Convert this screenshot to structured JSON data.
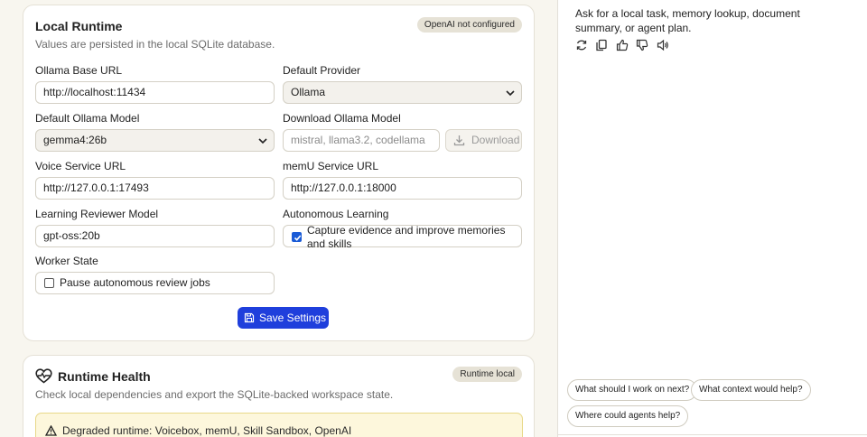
{
  "settings": {
    "title": "Local Runtime",
    "subtitle": "Values are persisted in the local SQLite database.",
    "badge": "OpenAI not configured",
    "ollama_base_url": {
      "label": "Ollama Base URL",
      "value": "http://localhost:11434"
    },
    "default_provider": {
      "label": "Default Provider",
      "value": "Ollama"
    },
    "default_model": {
      "label": "Default Ollama Model",
      "value": "gemma4:26b"
    },
    "download_model": {
      "label": "Download Ollama Model",
      "placeholder": "mistral, llama3.2, codellama",
      "button": "Download"
    },
    "voice_url": {
      "label": "Voice Service URL",
      "value": "http://127.0.0.1:17493"
    },
    "memu_url": {
      "label": "memU Service URL",
      "value": "http://127.0.0.1:18000"
    },
    "reviewer_model": {
      "label": "Learning Reviewer Model",
      "value": "gpt-oss:20b"
    },
    "autonomous": {
      "label": "Autonomous Learning",
      "text": "Capture evidence and improve memories and skills",
      "checked": true
    },
    "worker": {
      "label": "Worker State",
      "text": "Pause autonomous review jobs",
      "checked": false
    },
    "save_label": "Save Settings"
  },
  "health": {
    "title": "Runtime Health",
    "subtitle": "Check local dependencies and export the SQLite-backed workspace state.",
    "badge": "Runtime local",
    "warning": "Degraded runtime: Voicebox, memU, Skill Sandbox, OpenAI"
  },
  "chat": {
    "message": "Ask for a local task, memory lookup, document summary, or agent plan.",
    "actions": [
      "regenerate-icon",
      "copy-icon",
      "thumbs-up-icon",
      "thumbs-down-icon",
      "speaker-icon"
    ],
    "suggestions": [
      "What should I work on next?",
      "What context would help?",
      "Where could agents help?"
    ]
  },
  "colors": {
    "accent": "#1f3fdc",
    "warning_bg": "#fdf7dc",
    "badge_bg": "#e6e2d6"
  }
}
